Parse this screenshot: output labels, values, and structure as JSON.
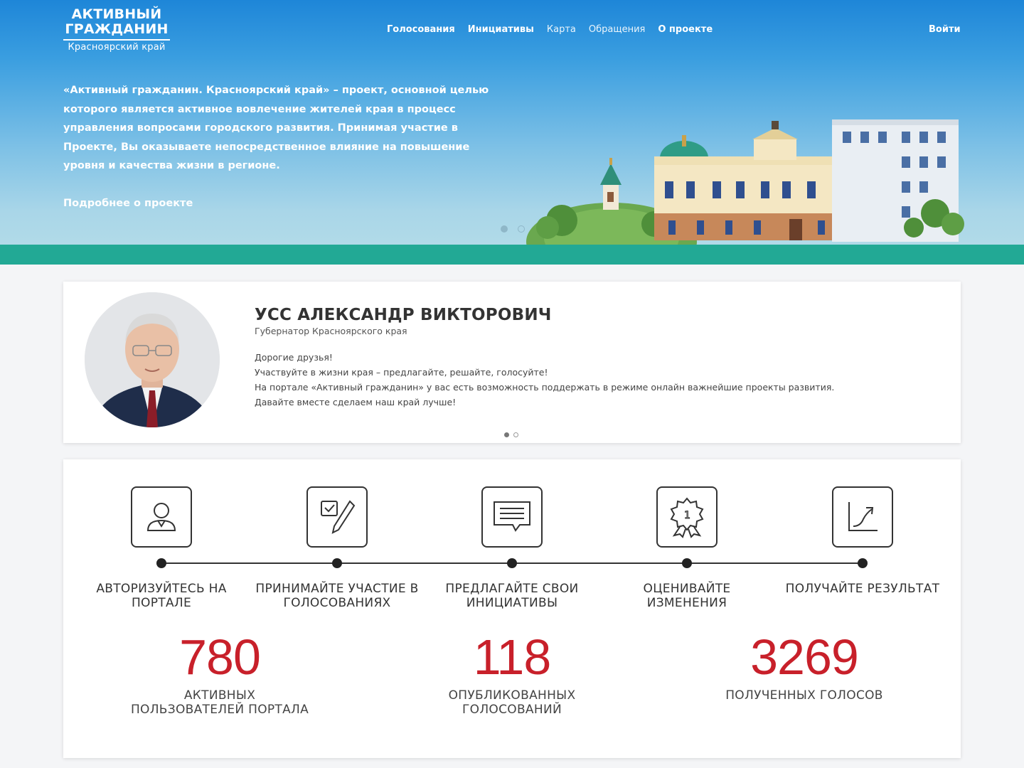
{
  "logo": {
    "line1": "АКТИВНЫЙ",
    "line2": "ГРАЖДАНИН",
    "region": "Красноярский край"
  },
  "nav": {
    "items": [
      {
        "label": "Голосования"
      },
      {
        "label": "Инициативы"
      },
      {
        "label": "Карта"
      },
      {
        "label": "Обращения"
      },
      {
        "label": "О проекте"
      }
    ],
    "login": "Войти"
  },
  "hero": {
    "text": "«Активный гражданин. Красноярский край» – проект, основной целью которого является активное вовлечение жителей края в процесс управления вопросами городского развития. Принимая участие в Проекте, Вы оказываете непосредственное влияние на повышение уровня и качества жизни в регионе.",
    "more_link": "Подробнее о проекте"
  },
  "governor": {
    "name": "УСС АЛЕКСАНДР ВИКТОРОВИЧ",
    "role": "Губернатор Красноярского края",
    "greeting": "Дорогие друзья!",
    "line1": "Участвуйте в жизни края – предлагайте, решайте, голосуйте!",
    "line2": "На портале «Активный гражданин» у вас есть возможность поддержать в режиме онлайн важнейшие проекты развития.",
    "line3": "Давайте вместе сделаем наш край лучше!"
  },
  "steps": [
    {
      "label": "Авторизуйтесь на портале",
      "icon": "user-icon"
    },
    {
      "label": "Принимайте участие в голосованиях",
      "icon": "vote-pen-icon"
    },
    {
      "label": "Предлагайте свои инициативы",
      "icon": "message-icon"
    },
    {
      "label": "Оценивайте изменения",
      "icon": "award-icon"
    },
    {
      "label": "Получайте результат",
      "icon": "growth-chart-icon"
    }
  ],
  "stats": [
    {
      "value": "780",
      "label": "Активных пользователей портала"
    },
    {
      "value": "118",
      "label": "Опубликованных голосований"
    },
    {
      "value": "3269",
      "label": "Полученных голосов"
    }
  ],
  "colors": {
    "hero_top": "#1e86d8",
    "ground": "#22a995",
    "stat_number": "#c8202a"
  }
}
